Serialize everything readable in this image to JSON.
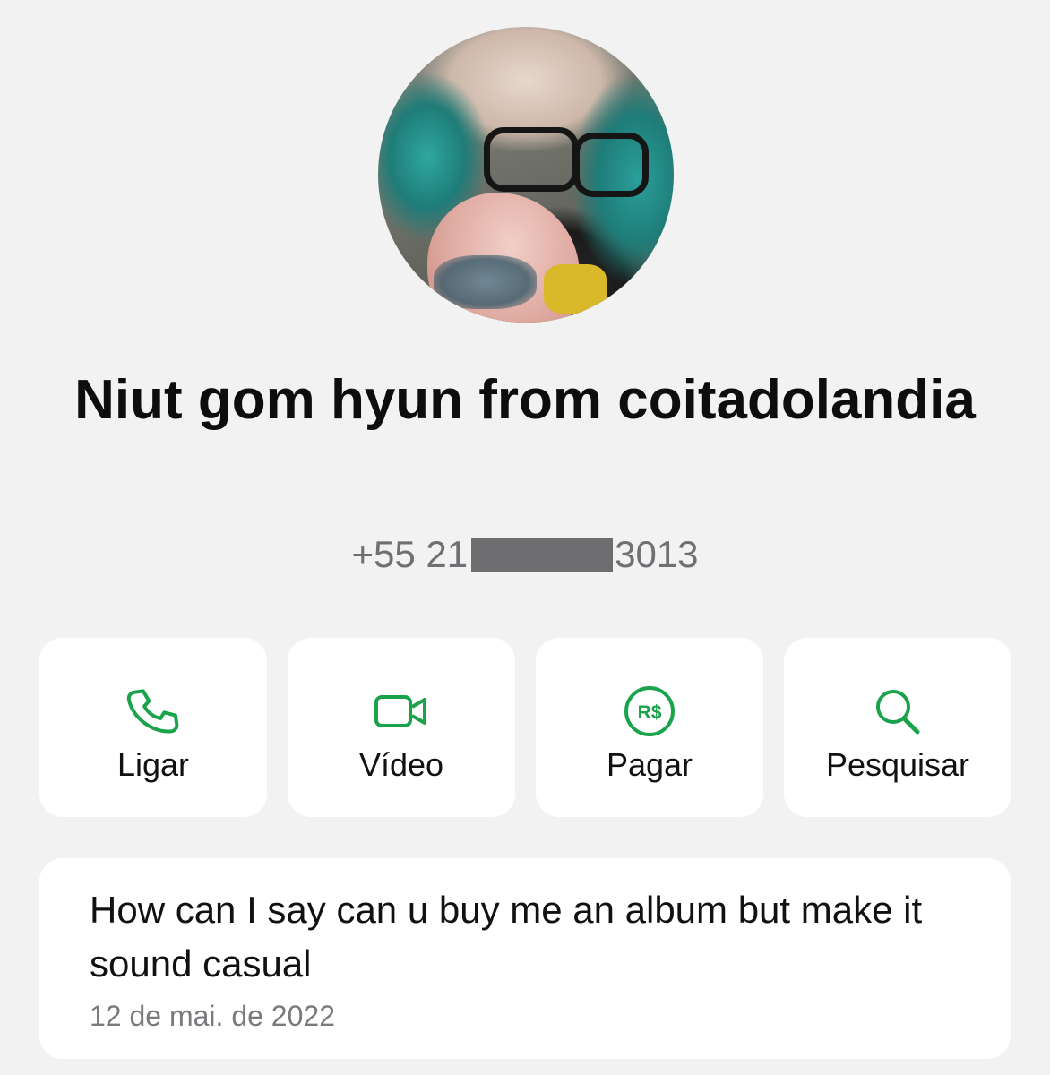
{
  "contact": {
    "name": "Niut gom hyun from coitadolandia",
    "phone_prefix": "+55 21",
    "phone_suffix": "3013"
  },
  "actions": [
    {
      "label": "Ligar",
      "icon": "phone-icon"
    },
    {
      "label": "Vídeo",
      "icon": "video-camera-icon"
    },
    {
      "label": "Pagar",
      "icon": "pay-brl-icon",
      "icon_text": "R$"
    },
    {
      "label": "Pesquisar",
      "icon": "search-icon"
    }
  ],
  "about": {
    "text": "How can I say can u buy me an album but make it sound casual",
    "date": "12 de mai. de 2022"
  },
  "colors": {
    "background": "#f2f2f2",
    "card": "#ffffff",
    "accent": "#1aa34a",
    "secondary_text": "#6f6f74"
  }
}
